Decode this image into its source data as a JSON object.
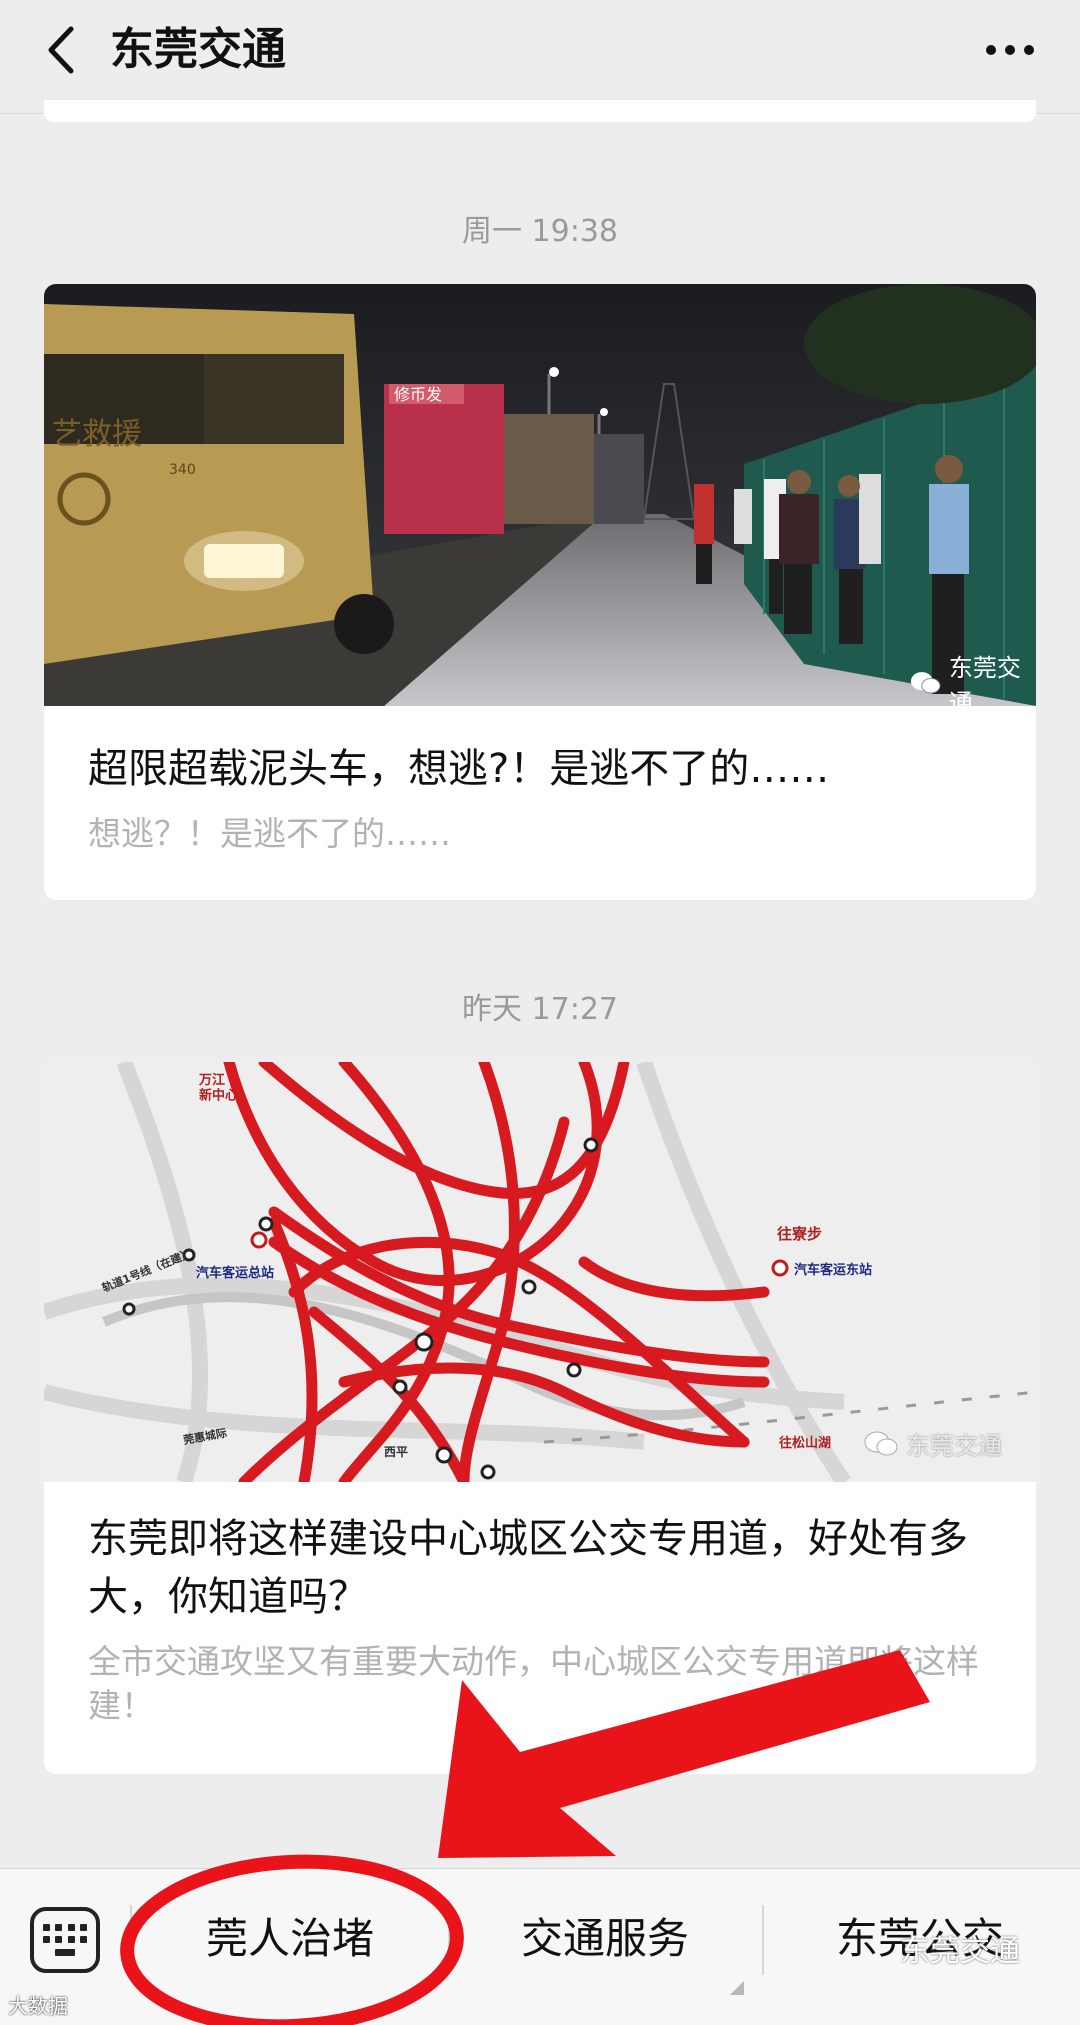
{
  "header": {
    "title": "东莞交通",
    "back_icon": "chevron-left-icon",
    "more_icon": "more-dots-icon"
  },
  "feed": [
    {
      "time": "周一 19:38",
      "title": "超限超载泥头车，想逃?！是逃不了的……",
      "summary": "想逃？！是逃不了的……",
      "image": {
        "truck_text": "艺救援",
        "truck_model": "340",
        "truck2_text": "修币发",
        "watermark": "东莞交通"
      }
    },
    {
      "time": "昨天 17:27",
      "title": "东莞即将这样建设中心城区公交专用道，好处有多大，你知道吗？",
      "summary": "全市交通攻坚又有重要大动作，中心城区公交专用道即将这样建！",
      "image": {
        "labels": {
          "top_left": "万江\n新中心",
          "station_west": "汽车客运总站",
          "metro": "轨道1号线（在建）",
          "east_dir": "往寮步",
          "station_east": "汽车客运东站",
          "southeast_dir": "往松山湖",
          "south": "西平",
          "southwest": "莞惠城际"
        },
        "watermark": "东莞交通"
      }
    }
  ],
  "bottom_menu": {
    "keyboard_icon": "keyboard-icon",
    "items": [
      "莞人治堵",
      "交通服务",
      "东莞公交"
    ]
  },
  "overlay": {
    "annotation_color": "#e8141a",
    "corner_watermark": "大数据",
    "footer_watermark": "东莞交通"
  }
}
